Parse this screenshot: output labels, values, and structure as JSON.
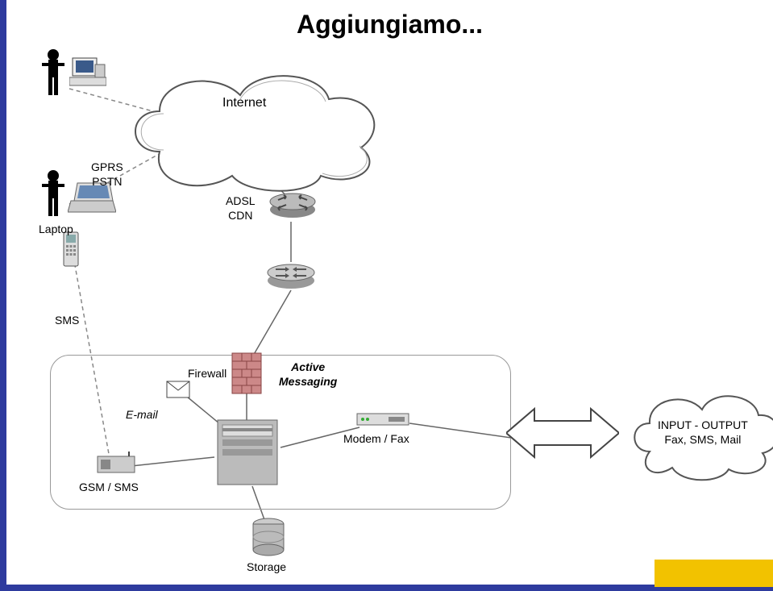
{
  "title": "Aggiungiamo...",
  "nodes": {
    "internet": "Internet",
    "gprs_pstn": "GPRS\nPSTN",
    "laptop": "Laptop",
    "adsl_cdn": "ADSL\nCDN",
    "sms": "SMS",
    "firewall": "Firewall",
    "active_messaging": "Active\nMessaging",
    "email": "E-mail",
    "modem_fax": "Modem / Fax",
    "gsm_sms": "GSM / SMS",
    "storage": "Storage",
    "input_output": "INPUT - OUTPUT\nFax, SMS, Mail"
  }
}
